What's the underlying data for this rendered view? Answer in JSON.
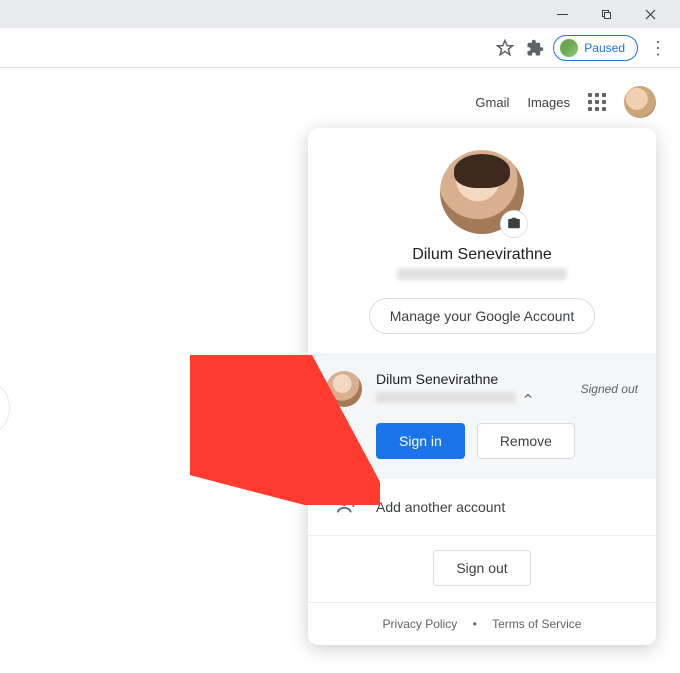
{
  "window": {
    "min_title": "Minimize",
    "max_title": "Maximize",
    "close_title": "Close"
  },
  "omnibox": {
    "paused_label": "Paused"
  },
  "nav": {
    "gmail": "Gmail",
    "images": "Images"
  },
  "account": {
    "name": "Dilum Senevirathne",
    "manage": "Manage your Google Account",
    "other_name": "Dilum Senevirathne",
    "signed_out": "Signed out",
    "sign_in": "Sign in",
    "remove": "Remove",
    "add_another": "Add another account",
    "sign_out": "Sign out",
    "privacy": "Privacy Policy",
    "bullet": "•",
    "terms": "Terms of Service"
  }
}
